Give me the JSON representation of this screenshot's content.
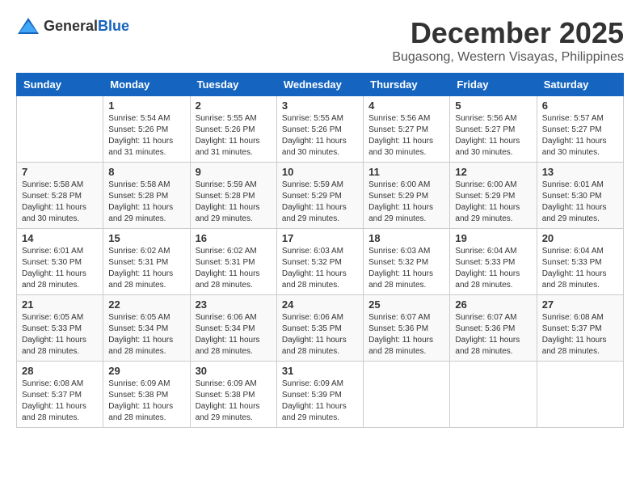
{
  "logo": {
    "general": "General",
    "blue": "Blue"
  },
  "title": "December 2025",
  "subtitle": "Bugasong, Western Visayas, Philippines",
  "days_of_week": [
    "Sunday",
    "Monday",
    "Tuesday",
    "Wednesday",
    "Thursday",
    "Friday",
    "Saturday"
  ],
  "weeks": [
    [
      {
        "day": "",
        "info": ""
      },
      {
        "day": "1",
        "info": "Sunrise: 5:54 AM\nSunset: 5:26 PM\nDaylight: 11 hours\nand 31 minutes."
      },
      {
        "day": "2",
        "info": "Sunrise: 5:55 AM\nSunset: 5:26 PM\nDaylight: 11 hours\nand 31 minutes."
      },
      {
        "day": "3",
        "info": "Sunrise: 5:55 AM\nSunset: 5:26 PM\nDaylight: 11 hours\nand 30 minutes."
      },
      {
        "day": "4",
        "info": "Sunrise: 5:56 AM\nSunset: 5:27 PM\nDaylight: 11 hours\nand 30 minutes."
      },
      {
        "day": "5",
        "info": "Sunrise: 5:56 AM\nSunset: 5:27 PM\nDaylight: 11 hours\nand 30 minutes."
      },
      {
        "day": "6",
        "info": "Sunrise: 5:57 AM\nSunset: 5:27 PM\nDaylight: 11 hours\nand 30 minutes."
      }
    ],
    [
      {
        "day": "7",
        "info": "Sunrise: 5:58 AM\nSunset: 5:28 PM\nDaylight: 11 hours\nand 30 minutes."
      },
      {
        "day": "8",
        "info": "Sunrise: 5:58 AM\nSunset: 5:28 PM\nDaylight: 11 hours\nand 29 minutes."
      },
      {
        "day": "9",
        "info": "Sunrise: 5:59 AM\nSunset: 5:28 PM\nDaylight: 11 hours\nand 29 minutes."
      },
      {
        "day": "10",
        "info": "Sunrise: 5:59 AM\nSunset: 5:29 PM\nDaylight: 11 hours\nand 29 minutes."
      },
      {
        "day": "11",
        "info": "Sunrise: 6:00 AM\nSunset: 5:29 PM\nDaylight: 11 hours\nand 29 minutes."
      },
      {
        "day": "12",
        "info": "Sunrise: 6:00 AM\nSunset: 5:29 PM\nDaylight: 11 hours\nand 29 minutes."
      },
      {
        "day": "13",
        "info": "Sunrise: 6:01 AM\nSunset: 5:30 PM\nDaylight: 11 hours\nand 29 minutes."
      }
    ],
    [
      {
        "day": "14",
        "info": "Sunrise: 6:01 AM\nSunset: 5:30 PM\nDaylight: 11 hours\nand 28 minutes."
      },
      {
        "day": "15",
        "info": "Sunrise: 6:02 AM\nSunset: 5:31 PM\nDaylight: 11 hours\nand 28 minutes."
      },
      {
        "day": "16",
        "info": "Sunrise: 6:02 AM\nSunset: 5:31 PM\nDaylight: 11 hours\nand 28 minutes."
      },
      {
        "day": "17",
        "info": "Sunrise: 6:03 AM\nSunset: 5:32 PM\nDaylight: 11 hours\nand 28 minutes."
      },
      {
        "day": "18",
        "info": "Sunrise: 6:03 AM\nSunset: 5:32 PM\nDaylight: 11 hours\nand 28 minutes."
      },
      {
        "day": "19",
        "info": "Sunrise: 6:04 AM\nSunset: 5:33 PM\nDaylight: 11 hours\nand 28 minutes."
      },
      {
        "day": "20",
        "info": "Sunrise: 6:04 AM\nSunset: 5:33 PM\nDaylight: 11 hours\nand 28 minutes."
      }
    ],
    [
      {
        "day": "21",
        "info": "Sunrise: 6:05 AM\nSunset: 5:33 PM\nDaylight: 11 hours\nand 28 minutes."
      },
      {
        "day": "22",
        "info": "Sunrise: 6:05 AM\nSunset: 5:34 PM\nDaylight: 11 hours\nand 28 minutes."
      },
      {
        "day": "23",
        "info": "Sunrise: 6:06 AM\nSunset: 5:34 PM\nDaylight: 11 hours\nand 28 minutes."
      },
      {
        "day": "24",
        "info": "Sunrise: 6:06 AM\nSunset: 5:35 PM\nDaylight: 11 hours\nand 28 minutes."
      },
      {
        "day": "25",
        "info": "Sunrise: 6:07 AM\nSunset: 5:36 PM\nDaylight: 11 hours\nand 28 minutes."
      },
      {
        "day": "26",
        "info": "Sunrise: 6:07 AM\nSunset: 5:36 PM\nDaylight: 11 hours\nand 28 minutes."
      },
      {
        "day": "27",
        "info": "Sunrise: 6:08 AM\nSunset: 5:37 PM\nDaylight: 11 hours\nand 28 minutes."
      }
    ],
    [
      {
        "day": "28",
        "info": "Sunrise: 6:08 AM\nSunset: 5:37 PM\nDaylight: 11 hours\nand 28 minutes."
      },
      {
        "day": "29",
        "info": "Sunrise: 6:09 AM\nSunset: 5:38 PM\nDaylight: 11 hours\nand 28 minutes."
      },
      {
        "day": "30",
        "info": "Sunrise: 6:09 AM\nSunset: 5:38 PM\nDaylight: 11 hours\nand 29 minutes."
      },
      {
        "day": "31",
        "info": "Sunrise: 6:09 AM\nSunset: 5:39 PM\nDaylight: 11 hours\nand 29 minutes."
      },
      {
        "day": "",
        "info": ""
      },
      {
        "day": "",
        "info": ""
      },
      {
        "day": "",
        "info": ""
      }
    ]
  ]
}
